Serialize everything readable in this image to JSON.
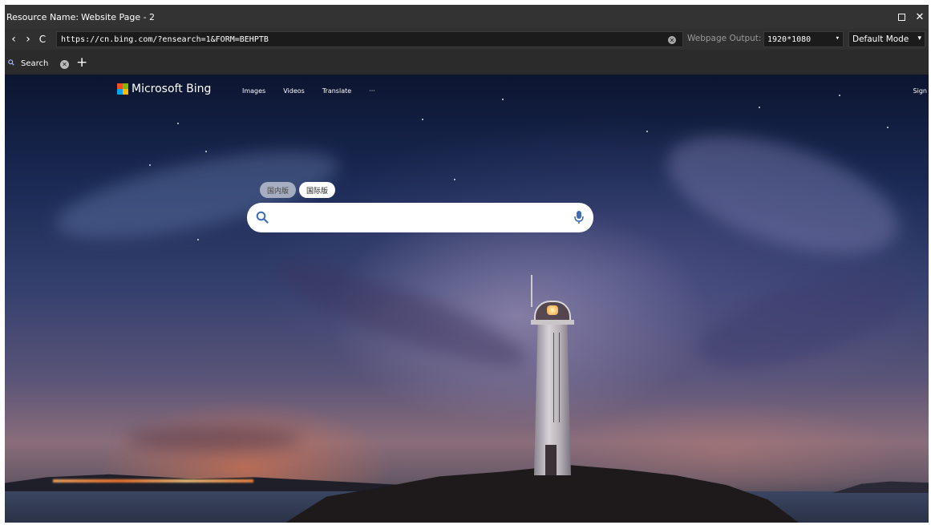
{
  "window": {
    "title_prefix": "Resource Name:",
    "title": "Website Page - 2",
    "maximize_icon": "maximize-icon",
    "close_icon": "close-icon",
    "close_glyph": "✕"
  },
  "nav": {
    "back_glyph": "‹",
    "forward_glyph": "›",
    "refresh_glyph": "C",
    "url": "https://cn.bing.com/?ensearch=1&FORM=BEHPTB",
    "clear_glyph": "✕",
    "output_label": "Webpage Output:",
    "resolution": "1920*1080",
    "mode": "Default Mode",
    "caret": "▾"
  },
  "tabs": {
    "items": [
      {
        "label": "Search",
        "icon": "search-icon"
      }
    ],
    "close_glyph": "✕",
    "add_glyph": "+"
  },
  "bing": {
    "logo_text": "Microsoft Bing",
    "nav": [
      "Images",
      "Videos",
      "Translate",
      "···"
    ],
    "sign_in": "Sign",
    "pills": [
      "国内版",
      "国际版"
    ],
    "active_pill": 1,
    "search_placeholder": "",
    "colors": {
      "ms_red": "#f25022",
      "ms_green": "#7fba00",
      "ms_blue": "#00a4ef",
      "ms_yellow": "#ffb900",
      "search_icon": "#3f6db5"
    }
  }
}
